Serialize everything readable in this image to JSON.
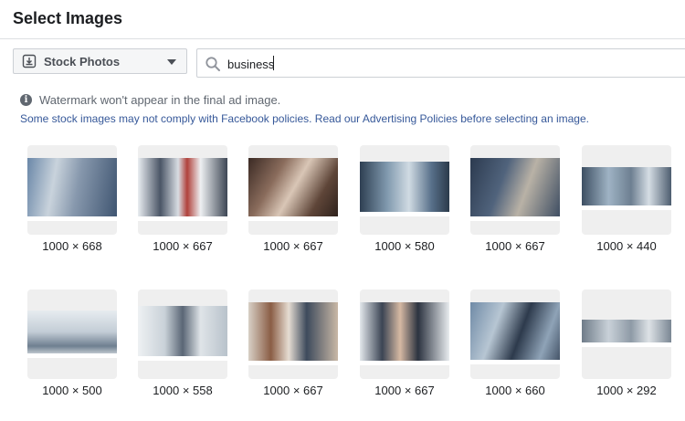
{
  "header": {
    "title": "Select Images"
  },
  "search": {
    "source_label": "Stock Photos",
    "source_icon": "stock-photo-icon",
    "query": "business"
  },
  "notices": {
    "watermark": "Watermark won't appear in the final ad image.",
    "policy": "Some stock images may not comply with Facebook policies. Read our Advertising Policies before selecting an image."
  },
  "images": [
    {
      "dims": "1000 × 668"
    },
    {
      "dims": "1000 × 667"
    },
    {
      "dims": "1000 × 667"
    },
    {
      "dims": "1000 × 580"
    },
    {
      "dims": "1000 × 667"
    },
    {
      "dims": "1000 × 440"
    },
    {
      "dims": "1000 × 500"
    },
    {
      "dims": "1000 × 558"
    },
    {
      "dims": "1000 × 667"
    },
    {
      "dims": "1000 × 667"
    },
    {
      "dims": "1000 × 660"
    },
    {
      "dims": "1000 × 292"
    }
  ]
}
